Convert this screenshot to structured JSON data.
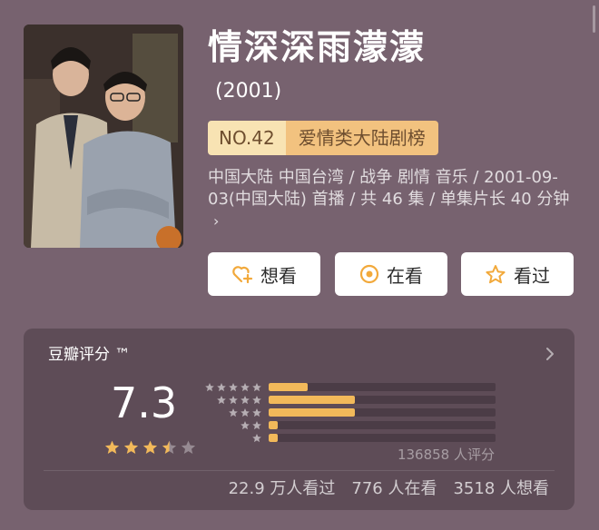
{
  "header": {
    "title": "情深深雨濛濛",
    "year": "(2001)",
    "rank_no": "NO.42",
    "rank_list": "爱情类大陆剧榜"
  },
  "meta": {
    "text": "中国大陆 中国台湾 / 战争 剧情 音乐 / 2001-09-03(中国大陆) 首播 / 共 46 集 / 单集片长 40 分钟",
    "arrow": "›"
  },
  "actions": [
    {
      "label": "想看",
      "icon": "heart-plus-icon"
    },
    {
      "label": "在看",
      "icon": "target-icon"
    },
    {
      "label": "看过",
      "icon": "star-outline-icon"
    }
  ],
  "rating": {
    "title": "豆瓣评分 ™",
    "score": "7.3",
    "score_stars": 3.5,
    "count_text": "136858 人评分",
    "distribution": [
      {
        "stars": 5,
        "fraction": 0.17
      },
      {
        "stars": 4,
        "fraction": 0.38
      },
      {
        "stars": 3,
        "fraction": 0.38
      },
      {
        "stars": 2,
        "fraction": 0.04
      },
      {
        "stars": 1,
        "fraction": 0.04
      }
    ]
  },
  "stats": {
    "watched": "22.9 万人看过",
    "watching": "776 人在看",
    "wish": "3518 人想看"
  },
  "colors": {
    "background": "#77626f",
    "card": "#5e4c57",
    "accent_gold": "#f2b95a",
    "badge_light": "#f8e3b3",
    "badge_dark": "#f2c27f"
  }
}
